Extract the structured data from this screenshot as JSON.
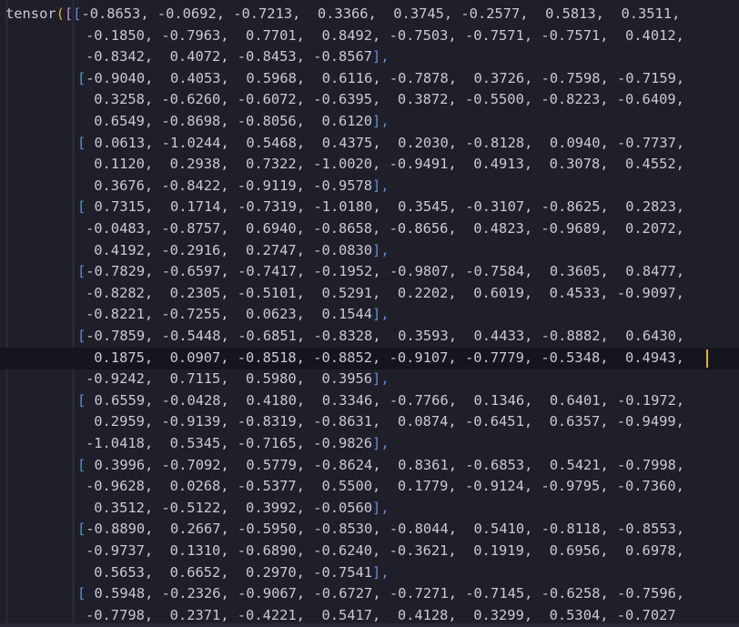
{
  "editor": {
    "prefix": "tensor",
    "open_round": "(",
    "open_square_outer": "[",
    "open_square_row": "[",
    "close_row": "],",
    "lines": [
      {
        "bracket": "[",
        "text": "-0.8653, -0.0692, -0.7213,  0.3366,  0.3745, -0.2577,  0.5813,  0.3511,"
      },
      {
        "bracket": "",
        "text": "-0.1850, -0.7963,  0.7701,  0.8492, -0.7503, -0.7571, -0.7571,  0.4012,"
      },
      {
        "bracket": "",
        "text": "-0.8342,  0.4072, -0.8453, -0.8567",
        "close": "],"
      },
      {
        "bracket": "[",
        "text": "-0.9040,  0.4053,  0.5968,  0.6116, -0.7878,  0.3726, -0.7598, -0.7159,"
      },
      {
        "bracket": "",
        "text": " 0.3258, -0.6260, -0.6072, -0.6395,  0.3872, -0.5500, -0.8223, -0.6409,"
      },
      {
        "bracket": "",
        "text": " 0.6549, -0.8698, -0.8056,  0.6120",
        "close": "],"
      },
      {
        "bracket": "[",
        "text": " 0.0613, -1.0244,  0.5468,  0.4375,  0.2030, -0.8128,  0.0940, -0.7737,"
      },
      {
        "bracket": "",
        "text": " 0.1120,  0.2938,  0.7322, -1.0020, -0.9491,  0.4913,  0.3078,  0.4552,"
      },
      {
        "bracket": "",
        "text": " 0.3676, -0.8422, -0.9119, -0.9578",
        "close": "],"
      },
      {
        "bracket": "[",
        "text": " 0.7315,  0.1714, -0.7319, -1.0180,  0.3545, -0.3107, -0.8625,  0.2823,"
      },
      {
        "bracket": "",
        "text": "-0.0483, -0.8757,  0.6940, -0.8658, -0.8656,  0.4823, -0.9689,  0.2072,"
      },
      {
        "bracket": "",
        "text": " 0.4192, -0.2916,  0.2747, -0.0830",
        "close": "],"
      },
      {
        "bracket": "[",
        "text": "-0.7829, -0.6597, -0.7417, -0.1952, -0.9807, -0.7584,  0.3605,  0.8477,"
      },
      {
        "bracket": "",
        "text": "-0.8282,  0.2305, -0.5101,  0.5291,  0.2202,  0.6019,  0.4533, -0.9097,"
      },
      {
        "bracket": "",
        "text": "-0.8221, -0.7255,  0.0623,  0.1544",
        "close": "],"
      },
      {
        "bracket": "[",
        "text": "-0.7859, -0.5448, -0.6851, -0.8328,  0.3593,  0.4433, -0.8882,  0.6430,"
      },
      {
        "bracket": "",
        "text": " 0.1875,  0.0907, -0.8518, -0.8852, -0.9107, -0.7779, -0.5348,  0.4943,"
      },
      {
        "bracket": "",
        "text": "-0.9242,  0.7115,  0.5980,  0.3956",
        "close": "],"
      },
      {
        "bracket": "[",
        "text": " 0.6559, -0.0428,  0.4180,  0.3346, -0.7766,  0.1346,  0.6401, -0.1972,"
      },
      {
        "bracket": "",
        "text": " 0.2959, -0.9139, -0.8319, -0.8631,  0.0874, -0.6451,  0.6357, -0.9499,"
      },
      {
        "bracket": "",
        "text": "-1.0418,  0.5345, -0.7165, -0.9826",
        "close": "],"
      },
      {
        "bracket": "[",
        "text": " 0.3996, -0.7092,  0.5779, -0.8624,  0.8361, -0.6853,  0.5421, -0.7998,"
      },
      {
        "bracket": "",
        "text": "-0.9628,  0.0268, -0.5377,  0.5500,  0.1779, -0.9124, -0.9795, -0.7360,"
      },
      {
        "bracket": "",
        "text": " 0.3512, -0.5122,  0.3992, -0.0560",
        "close": "],"
      },
      {
        "bracket": "[",
        "text": "-0.8890,  0.2667, -0.5950, -0.8530, -0.8044,  0.5410, -0.8118, -0.8553,"
      },
      {
        "bracket": "",
        "text": "-0.9737,  0.1310, -0.6890, -0.6240, -0.3621,  0.1919,  0.6956,  0.6978,"
      },
      {
        "bracket": "",
        "text": " 0.5653,  0.6652,  0.2970, -0.7541",
        "close": "],"
      },
      {
        "bracket": "[",
        "text": " 0.5948, -0.2326, -0.9067, -0.6727, -0.7271, -0.7145, -0.6258, -0.7596,"
      },
      {
        "bracket": "",
        "text": "-0.7798,  0.2371, -0.4221,  0.5417,  0.4128,  0.3299,  0.5304, -0.7027"
      }
    ]
  },
  "colors": {
    "background": "#1f1f29",
    "text": "#c9c9d6",
    "paren_yellow": "#e0b33a",
    "bracket_purple": "#c98bd9",
    "bracket_blue": "#5f8dd6",
    "current_line": "#15151d",
    "cursor": "#e0b33a"
  }
}
